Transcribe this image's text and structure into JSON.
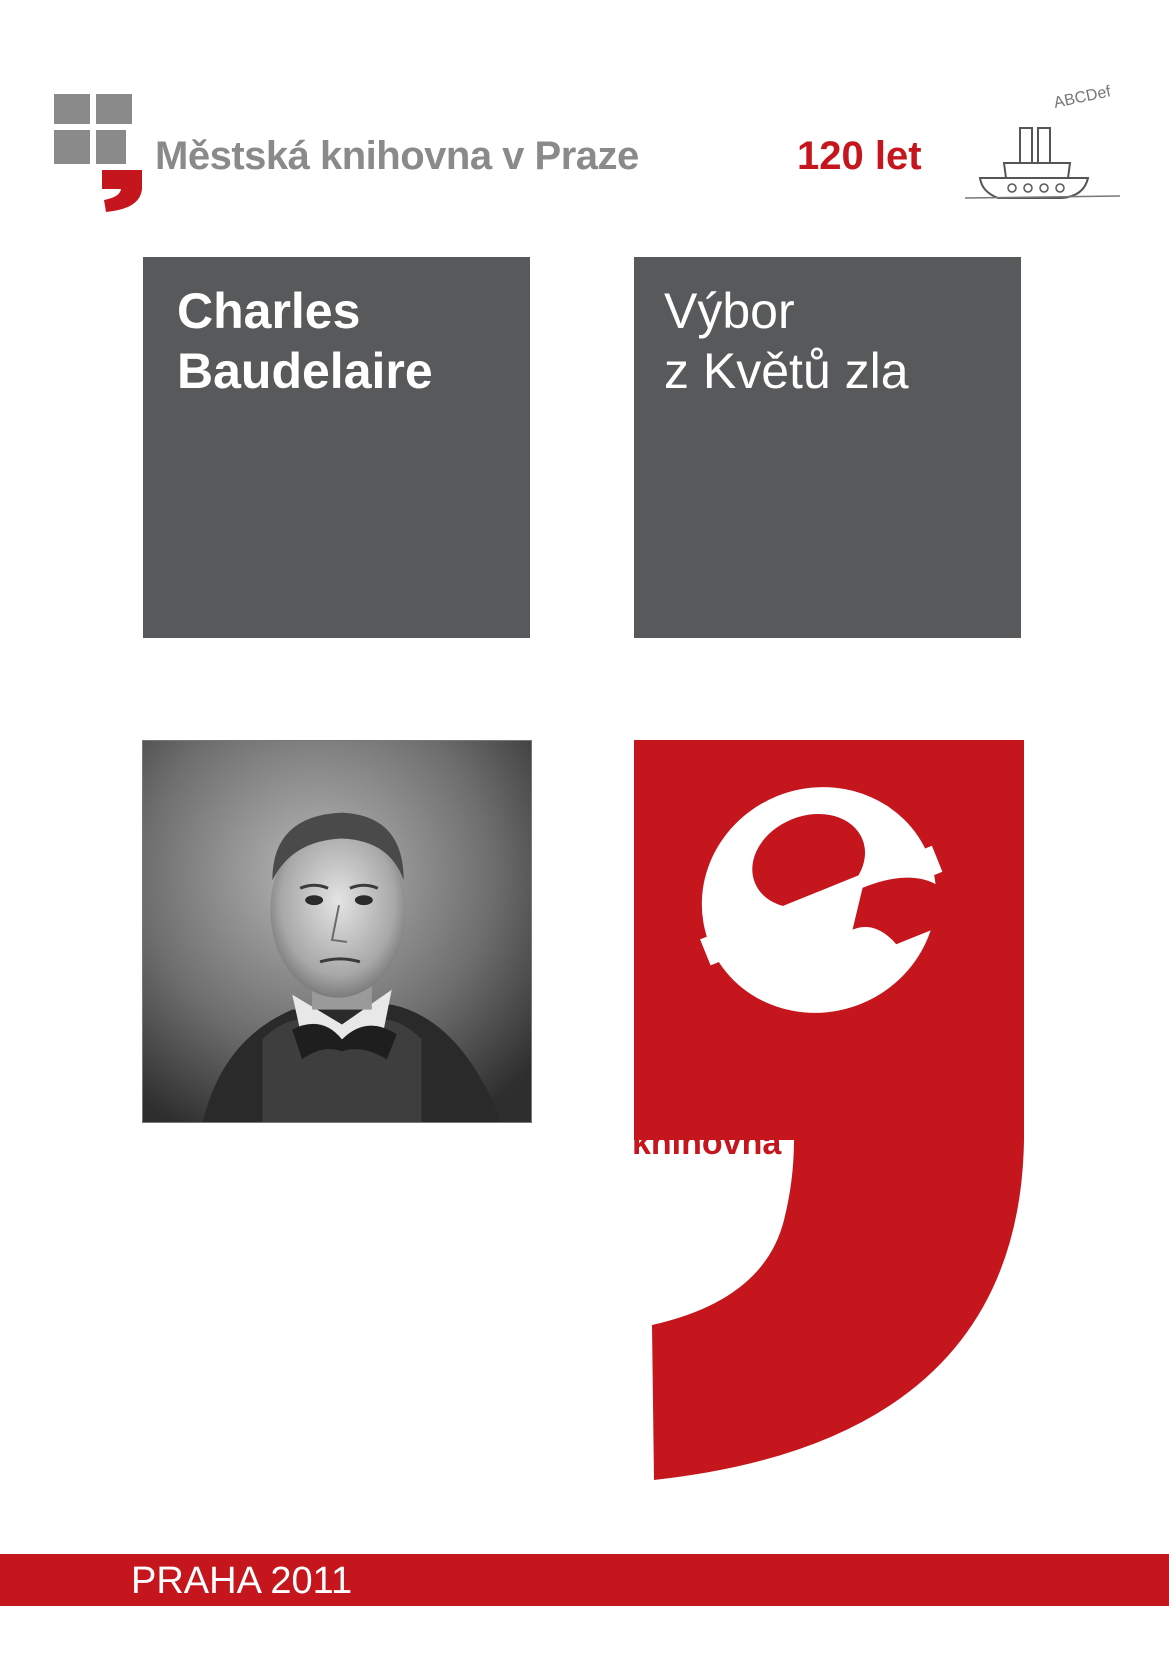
{
  "header": {
    "brand_name": "Městská knihovna v Praze",
    "anniversary": "120 let",
    "boat_doodle_text": "ABCDef",
    "logo_icon": "library-comma-logo-icon",
    "boat_icon": "steamboat-doodle-icon"
  },
  "book": {
    "author_lines": [
      "Charles",
      "Baudelaire"
    ],
    "title_lines": [
      "Výbor",
      "z Květů zla"
    ]
  },
  "portrait": {
    "icon": "author-portrait-photo"
  },
  "mark": {
    "label": "knihovna",
    "icon": "red-e-comma-mark-icon"
  },
  "footer": {
    "text": "PRAHA 2011"
  },
  "colors": {
    "brand_red": "#c4161c",
    "panel_grey": "#58595b",
    "logo_grey": "#8a8a8a"
  }
}
